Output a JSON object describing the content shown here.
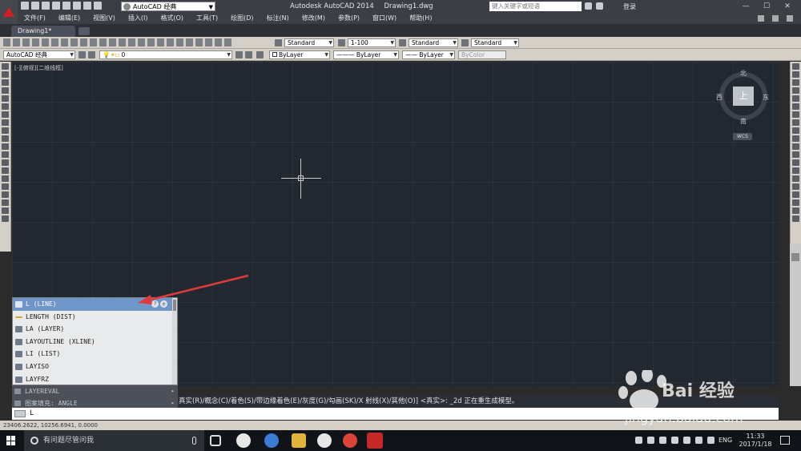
{
  "titlebar": {
    "workspace": "AutoCAD 经典",
    "app_title": "Autodesk AutoCAD 2014",
    "doc_title": "Drawing1.dwg",
    "search_placeholder": "键入关键字或短语",
    "login": "登录"
  },
  "menu": [
    "文件(F)",
    "编辑(E)",
    "视图(V)",
    "插入(I)",
    "格式(O)",
    "工具(T)",
    "绘图(D)",
    "标注(N)",
    "修改(M)",
    "参数(P)",
    "窗口(W)",
    "帮助(H)"
  ],
  "tabs": {
    "active": "Drawing1*"
  },
  "toolbar1": {
    "text_style": "Standard",
    "dim_scale": "1-100",
    "dim_style": "Standard",
    "table_style": "Standard"
  },
  "toolbar2": {
    "workspace": "AutoCAD 经典",
    "layer": "0",
    "color": "ByLayer",
    "linetype": "ByLayer",
    "lineweight": "ByLayer",
    "plotstyle": "ByColor"
  },
  "canvas": {
    "viewport_label": "[-][俯视][二维线框]"
  },
  "viewcube": {
    "north": "北",
    "south": "南",
    "east": "东",
    "west": "西",
    "top": "上",
    "wcs": "WCS"
  },
  "autocomplete": {
    "items": [
      "L (LINE)",
      "LENGTH (DIST)",
      "LA (LAYER)",
      "LAYOUTLINE (XLINE)",
      "LI (LIST)",
      "LAYISO",
      "LAYFRZ"
    ],
    "sub_items": [
      "LAYEREVAL",
      "图案填充: ANGLE"
    ]
  },
  "command": {
    "history": "真实(R)/概念(C)/着色(S)/带边缘着色(E)/灰度(G)/勾画(SK)/X 射线(X)/其他(O)] <真实>: _2d 正在重生成模型。",
    "input": "L"
  },
  "status": {
    "coords": "23406.2622, 10256.6941, 0.0000"
  },
  "taskbar": {
    "search_placeholder": "有问题尽管问我",
    "lang": "ENG",
    "time": "11:33",
    "date": "2017/1/18"
  },
  "watermark": {
    "brand": "Bai 经验",
    "url": "jingyan.baidu.com"
  },
  "colors": {
    "canvas_bg": "#212830",
    "accent_red": "#d42020",
    "selection": "#6f96c8"
  }
}
